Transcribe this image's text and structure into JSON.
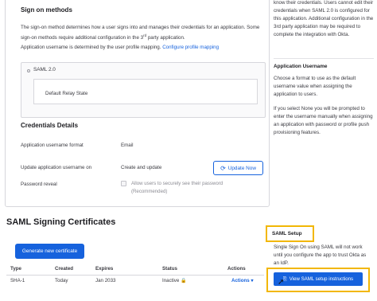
{
  "signon": {
    "title": "Sign on methods",
    "intro_a": "The sign-on method determines how a user signs into and manages their credentials for an application.",
    "intro_b": "Some sign-on methods require additional configuration in the 3",
    "intro_sup": "rd",
    "intro_c": " party application.",
    "username_text": "Application username is determined by the user profile mapping.",
    "username_link": "Configure profile mapping",
    "saml_label": "SAML 2.0",
    "relay_label": "Default Relay State"
  },
  "credentials": {
    "title": "Credentials Details",
    "rows": [
      {
        "label": "Application username format",
        "value": "Email"
      },
      {
        "label": "Update application username on",
        "value": "Create and update"
      },
      {
        "label": "Password reveal",
        "value": ""
      }
    ],
    "update_button": "Update Now",
    "checkbox_text": "Allow users to securely see their password (Recommended)"
  },
  "certificates": {
    "title": "SAML Signing Certificates",
    "generate_button": "Generate new certificate",
    "columns": [
      "Type",
      "Created",
      "Expires",
      "Status",
      "Actions"
    ],
    "rows": [
      {
        "type": "SHA-1",
        "created": "Today",
        "expires": "Jan 2033",
        "status": "Inactive",
        "actions": "Actions"
      }
    ]
  },
  "sidebar": {
    "top_text": "know their credentials. Users cannot edit their credentials when SAML 2.0 is configured for this application. Additional configuration in the 3rd party application may be required to complete the integration with Okta.",
    "username_title": "Application Username",
    "username_text": "Choose a format to use as the default username value when assigning the application to users.",
    "none_text": "If you select None you will be prompted to enter the username manually when assigning an application with password or profile push provisioning features.",
    "setup_title": "SAML Setup",
    "setup_text": "Single Sign On using SAML will not work until you configure the app to trust Okta as an IdP.",
    "view_button": "View SAML setup instructions"
  },
  "icons": {
    "refresh": "refresh-icon",
    "lock": "lock-icon",
    "document": "document-icon",
    "cursor": "pointer-cursor-icon"
  },
  "colors": {
    "primary": "#1662dd",
    "highlight": "#f2b705",
    "inactive_lock": "#e3a409"
  }
}
